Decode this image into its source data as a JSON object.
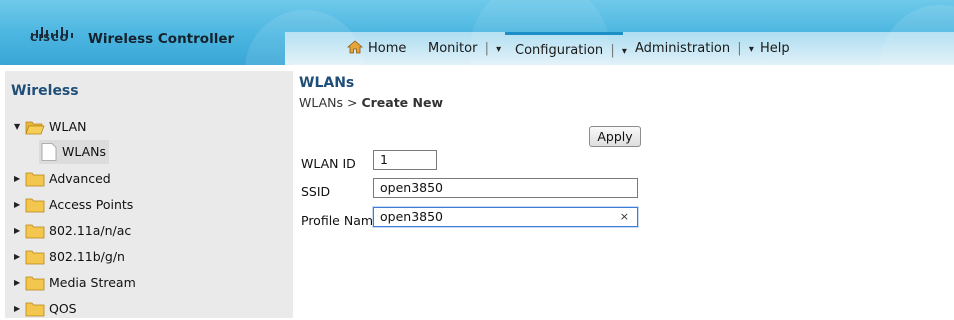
{
  "header": {
    "logo_text": "CISCO",
    "product_name": "Wireless Controller",
    "nav": [
      {
        "label": "Home",
        "icon": "home-icon"
      },
      {
        "label": "Monitor",
        "sep": "|",
        "caret": "▾"
      },
      {
        "label": "Configuration",
        "sep": "|",
        "caret": "▾",
        "active": true
      },
      {
        "label": "Administration",
        "sep": "|",
        "caret": "▾"
      },
      {
        "label": "Help"
      }
    ],
    "colors": {
      "header_bg": "#4ab5e0",
      "active_tab": "#1d8fc7"
    }
  },
  "sidebar": {
    "title": "Wireless",
    "items": [
      {
        "label": "WLAN",
        "expanded": true
      },
      {
        "label": "WLANs",
        "selected": true,
        "child": true
      },
      {
        "label": "Advanced"
      },
      {
        "label": "Access Points"
      },
      {
        "label": "802.11a/n/ac"
      },
      {
        "label": "802.11b/g/n"
      },
      {
        "label": "Media Stream"
      },
      {
        "label": "QOS"
      }
    ]
  },
  "main": {
    "title": "WLANs",
    "breadcrumb": {
      "parent": "WLANs",
      "separator": " > ",
      "current": "Create New"
    },
    "apply_label": "Apply",
    "form": {
      "wlan_id": {
        "label": "WLAN ID",
        "value": "1"
      },
      "ssid": {
        "label": "SSID",
        "value": "open3850"
      },
      "profile_name": {
        "label": "Profile Name",
        "value": "open3850",
        "clear_icon": "×"
      }
    }
  }
}
